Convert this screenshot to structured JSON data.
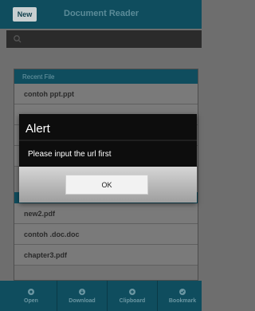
{
  "header": {
    "new_label": "New",
    "title": "Document Reader"
  },
  "search": {
    "icon": "search-icon"
  },
  "recent": {
    "header": "Recent File",
    "items": [
      "contoh ppt.ppt",
      "",
      "",
      "",
      "",
      "new2.pdf",
      "contoh .doc.doc",
      "chapter3.pdf"
    ]
  },
  "bottom_nav": [
    {
      "label": "Open",
      "icon": "open-icon"
    },
    {
      "label": "Download",
      "icon": "download-icon"
    },
    {
      "label": "Clipboard",
      "icon": "clipboard-icon"
    },
    {
      "label": "Bookmark",
      "icon": "bookmark-icon"
    }
  ],
  "dialog": {
    "title": "Alert",
    "message": "Please input the url first",
    "ok_label": "OK"
  },
  "colors": {
    "brand": "#0f4d5e",
    "dialog_bg": "#0d0d0d"
  }
}
